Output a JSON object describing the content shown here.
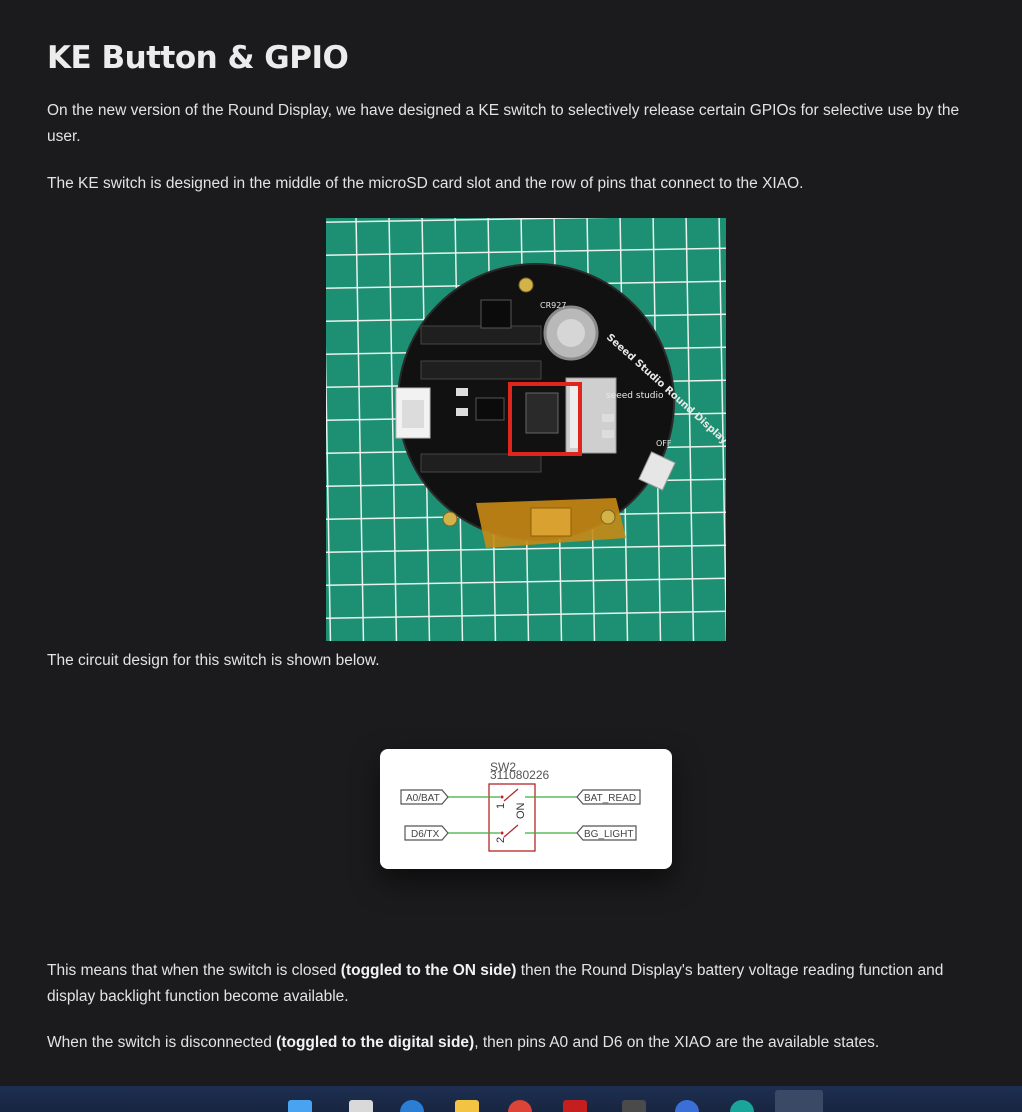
{
  "article": {
    "heading": "KE Button & GPIO",
    "intro": "On the new version of the Round Display, we have designed a KE switch to selectively release certain GPIOs for selective use by the user.",
    "location": "The KE switch is designed in the middle of the microSD card slot and the row of pins that connect to the XIAO.",
    "circuit_intro": "The circuit design for this switch is shown below.",
    "closed_pre": "This means that when the switch is closed ",
    "closed_bold": "(toggled to the ON side)",
    "closed_post": " then the Round Display's battery voltage reading function and display backlight function become available.",
    "open_pre": "When the switch is disconnected ",
    "open_bold": "(toggled to the digital side)",
    "open_post": ", then pins A0 and D6 on the XIAO are the available states."
  },
  "photo": {
    "silkscreen_brand": "Seeed Studio Round Display for XIAO",
    "battery_label": "CR927",
    "logo_text": "seeed studio",
    "off_label": "OFF"
  },
  "schematic": {
    "ref": "SW2",
    "part_number": "311080226",
    "left_labels": [
      "A0/BAT",
      "D6/TX"
    ],
    "right_labels": [
      "BAT_READ",
      "BG_LIGHT"
    ],
    "switch_text": "ON",
    "pin_numbers": [
      "1",
      "2"
    ]
  },
  "colors": {
    "background": "#1b1b1d",
    "text": "#e3e3e3",
    "mat_green": "#1a8a6e",
    "highlight_red": "#e0261c",
    "schematic_red": "#b3262a",
    "wire_green": "#3cad3c",
    "taskbar": "#1e2f52"
  },
  "taskbar_icons": [
    "windows-start-icon",
    "file-explorer-icon",
    "edge-icon",
    "folder-icon",
    "chrome-icon",
    "arduino-icon",
    "app-icon",
    "app-icon-2",
    "app-icon-3",
    "app-icon-4"
  ]
}
